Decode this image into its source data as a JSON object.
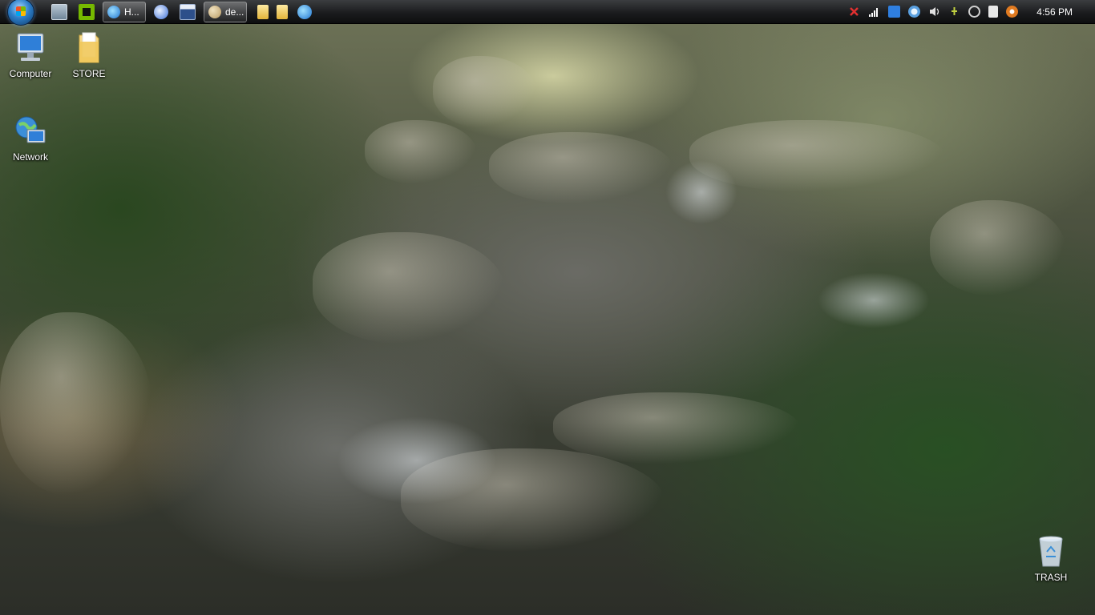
{
  "taskbar": {
    "start_icon": "windows-start-orb",
    "quick_launch": [
      {
        "icon": "show-desktop-icon",
        "color": "#8fa3b5"
      },
      {
        "icon": "nvidia-icon",
        "color": "#76b900"
      }
    ],
    "tasks": [
      {
        "label": "H...",
        "icon": "internet-explorer-icon",
        "color": "#2f8fe0"
      },
      {
        "label": "de...",
        "icon": "paint-palette-icon",
        "color": "#c9b48a"
      }
    ],
    "mid_launch": [
      {
        "icon": "browser-icon",
        "color": "#3b6fd8"
      },
      {
        "icon": "window-app-icon",
        "color": "#4b6fa8"
      }
    ],
    "after_launch": [
      {
        "icon": "folder-icon",
        "color": "#f1cc5b"
      },
      {
        "icon": "folder-icon",
        "color": "#f1cc5b"
      },
      {
        "icon": "internet-explorer-icon",
        "color": "#2f8fe0"
      }
    ],
    "tray": [
      {
        "icon": "network-error-icon",
        "color": "#e03030"
      },
      {
        "icon": "signal-bars-icon",
        "color": "#ffffff"
      },
      {
        "icon": "bluetooth-icon",
        "color": "#2f7fe0"
      },
      {
        "icon": "update-icon",
        "color": "#5aa0e0"
      },
      {
        "icon": "speaker-icon",
        "color": "#e0e0e0"
      },
      {
        "icon": "power-icon",
        "color": "#c0d040"
      },
      {
        "icon": "clock-sync-icon",
        "color": "#d0d0d0"
      },
      {
        "icon": "device-icon",
        "color": "#e8e8e8"
      },
      {
        "icon": "antivirus-icon",
        "color": "#e07a20"
      }
    ],
    "clock": "4:56 PM"
  },
  "desktop_icons": [
    {
      "name": "Computer",
      "icon": "computer-icon"
    },
    {
      "name": "STORE",
      "icon": "folder-icon"
    },
    {
      "name": "Network",
      "icon": "network-icon"
    },
    {
      "name": "TRASH",
      "icon": "recycle-bin-icon"
    }
  ]
}
